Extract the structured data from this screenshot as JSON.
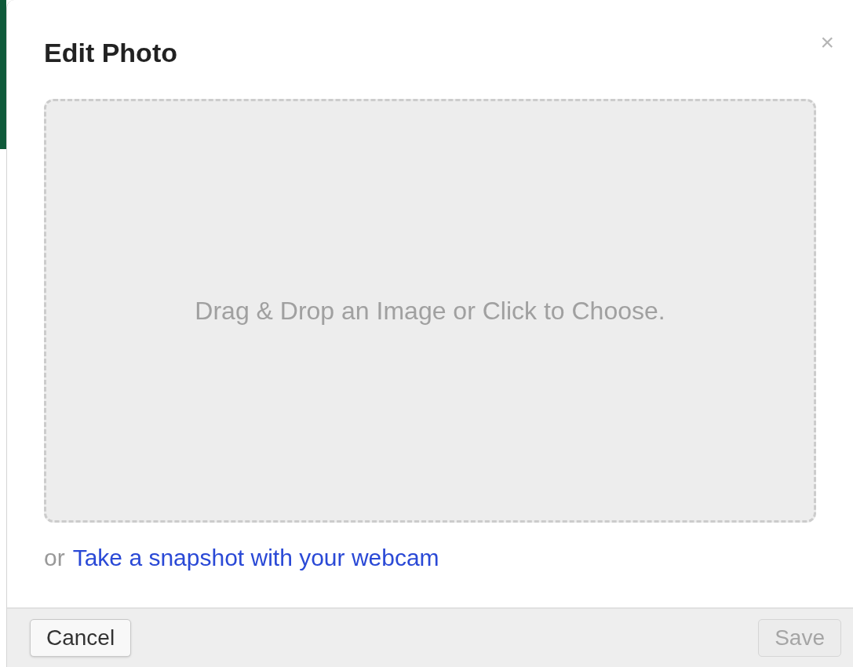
{
  "dialog": {
    "title": "Edit Photo",
    "close": "×"
  },
  "dropzone": {
    "prompt": "Drag & Drop an Image or Click to Choose."
  },
  "webcam": {
    "prefix": "or",
    "link": "Take a snapshot with your webcam"
  },
  "buttons": [
    {
      "label": "Cancel",
      "disabled": false
    },
    {
      "label": "Save",
      "disabled": true
    }
  ]
}
